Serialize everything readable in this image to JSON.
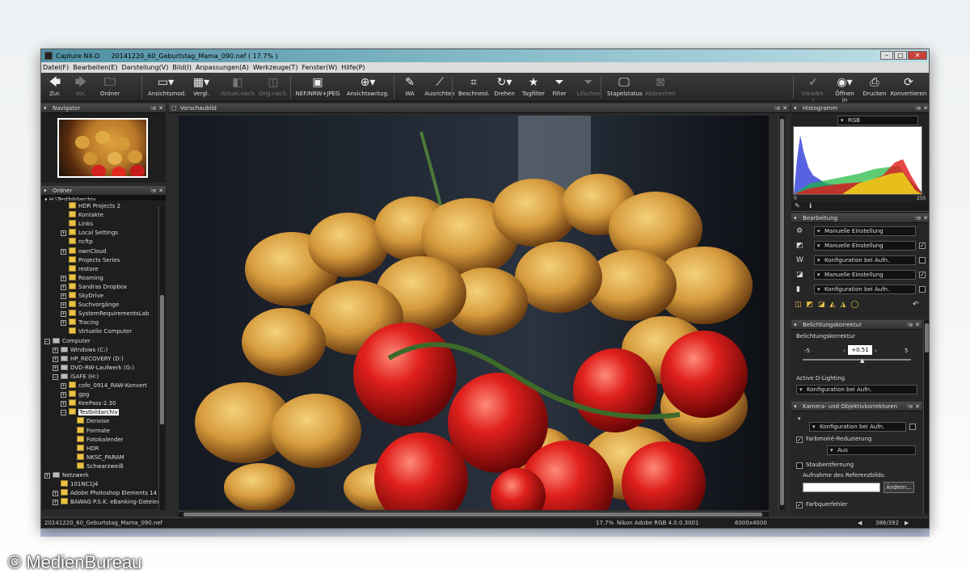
{
  "window": {
    "app_name": "Capture NX-D",
    "document_title": "20141220_60_Geburtstag_Mama_090.nef ( 17.7% )",
    "min": "–",
    "max": "□",
    "close": "✕"
  },
  "menu": [
    "Datei(F)",
    "Bearbeiten(E)",
    "Darstellung(V)",
    "Bild(I)",
    "Anpassungen(A)",
    "Werkzeuge(T)",
    "Fenster(W)",
    "Hilfe(P)"
  ],
  "toolbar": {
    "items": [
      {
        "label": "Zur.",
        "icon": "arrow-left-icon",
        "glyph": "🡄",
        "dim": false
      },
      {
        "label": "Vor.",
        "icon": "arrow-right-icon",
        "glyph": "🡆",
        "dim": true
      },
      {
        "label": "Ordner",
        "icon": "folder-icon",
        "glyph": "🗀",
        "dim": false
      },
      {
        "label": "Ansichtsmod.",
        "icon": "view-mode-icon",
        "glyph": "▭▾",
        "dim": false
      },
      {
        "label": "Vergl.",
        "icon": "compare-icon",
        "glyph": "▦▾",
        "dim": false
      },
      {
        "label": "Aktuel.nach.",
        "icon": "current-after-icon",
        "glyph": "◧",
        "dim": true
      },
      {
        "label": "Orig.nach.",
        "icon": "original-after-icon",
        "glyph": "◫",
        "dim": true
      },
      {
        "label": "NEF/NRW+JPEG",
        "icon": "nef-jpeg-icon",
        "glyph": "▣",
        "dim": false
      },
      {
        "label": "Ansichtswrkzg.",
        "icon": "view-tools-icon",
        "glyph": "⊕▾",
        "dim": false
      },
      {
        "label": "WA",
        "icon": "white-balance-icon",
        "glyph": "✎",
        "dim": false
      },
      {
        "label": "Ausrichten",
        "icon": "straighten-icon",
        "glyph": "⟋",
        "dim": false
      },
      {
        "label": "Beschneid.",
        "icon": "crop-icon",
        "glyph": "⌗",
        "dim": false
      },
      {
        "label": "Drehen",
        "icon": "rotate-icon",
        "glyph": "↻▾",
        "dim": false
      },
      {
        "label": "Tagfilter",
        "icon": "star-icon",
        "glyph": "★",
        "dim": false
      },
      {
        "label": "Filter",
        "icon": "filter-icon",
        "glyph": "⏷",
        "dim": false
      },
      {
        "label": "Löschen",
        "icon": "clear-filter-icon",
        "glyph": "⏷",
        "dim": true
      },
      {
        "label": "Stapelstatus",
        "icon": "batch-status-icon",
        "glyph": "🖵",
        "dim": false
      },
      {
        "label": "Abbrechen",
        "icon": "cancel-batch-icon",
        "glyph": "⊠",
        "dim": true
      },
      {
        "label": "ViewNX-i",
        "icon": "viewnx-icon",
        "glyph": "✔",
        "dim": true
      },
      {
        "label": "Öffnen in",
        "icon": "open-in-icon",
        "glyph": "◉▾",
        "dim": false
      },
      {
        "label": "Drucken",
        "icon": "printer-icon",
        "glyph": "⎙",
        "dim": false
      },
      {
        "label": "Konvertieren",
        "icon": "convert-icon",
        "glyph": "⟳",
        "dim": false
      }
    ]
  },
  "navigator": {
    "title": "Navigator"
  },
  "folders": {
    "title": "Ordner",
    "path": "H:\\Testbildarchiv",
    "rows": [
      {
        "label": "HDR Projects 2",
        "indent": 2,
        "type": "folder",
        "plus": false
      },
      {
        "label": "Kontakte",
        "indent": 2,
        "type": "folder",
        "plus": false
      },
      {
        "label": "Links",
        "indent": 2,
        "type": "folder",
        "plus": false
      },
      {
        "label": "Local Settings",
        "indent": 2,
        "type": "folder",
        "plus": true
      },
      {
        "label": "ncftp",
        "indent": 2,
        "type": "folder",
        "plus": false
      },
      {
        "label": "ownCloud",
        "indent": 2,
        "type": "folder",
        "plus": true
      },
      {
        "label": "Projects Series",
        "indent": 2,
        "type": "folder",
        "plus": false
      },
      {
        "label": "restore",
        "indent": 2,
        "type": "folder",
        "plus": false
      },
      {
        "label": "Roaming",
        "indent": 2,
        "type": "folder",
        "plus": true
      },
      {
        "label": "Sandras Dropbox",
        "indent": 2,
        "type": "folder",
        "plus": true
      },
      {
        "label": "SkyDrive",
        "indent": 2,
        "type": "folder",
        "plus": true
      },
      {
        "label": "Suchvorgänge",
        "indent": 2,
        "type": "folder",
        "plus": true
      },
      {
        "label": "SystemRequirementsLab",
        "indent": 2,
        "type": "folder",
        "plus": true
      },
      {
        "label": "Tracing",
        "indent": 2,
        "type": "folder",
        "plus": true
      },
      {
        "label": "Virtuelle Computer",
        "indent": 2,
        "type": "folder",
        "plus": false
      },
      {
        "label": "Computer",
        "indent": 0,
        "type": "drive",
        "plus": true
      },
      {
        "label": "Windows (C:)",
        "indent": 1,
        "type": "drive",
        "plus": true
      },
      {
        "label": "HP_RECOVERY (D:)",
        "indent": 1,
        "type": "drive",
        "plus": true
      },
      {
        "label": "DVD-RW-Laufwerk (G:)",
        "indent": 1,
        "type": "drive",
        "plus": true
      },
      {
        "label": "iSAFE (H:)",
        "indent": 1,
        "type": "drive",
        "plus": true
      },
      {
        "label": "cofo_0914_RAW-Konvert",
        "indent": 2,
        "type": "folder",
        "plus": true
      },
      {
        "label": "gpg",
        "indent": 2,
        "type": "folder",
        "plus": true
      },
      {
        "label": "KeePass-2.30",
        "indent": 2,
        "type": "folder",
        "plus": true
      },
      {
        "label": "Testbildarchiv",
        "indent": 2,
        "type": "folder",
        "plus": true,
        "selected": true
      },
      {
        "label": "Denoise",
        "indent": 3,
        "type": "folder",
        "plus": false
      },
      {
        "label": "Formate",
        "indent": 3,
        "type": "folder",
        "plus": false
      },
      {
        "label": "Fotokalender",
        "indent": 3,
        "type": "folder",
        "plus": false
      },
      {
        "label": "HDR",
        "indent": 3,
        "type": "folder",
        "plus": false
      },
      {
        "label": "NKSC_PARAM",
        "indent": 3,
        "type": "folder",
        "plus": false
      },
      {
        "label": "Schwarzweiß",
        "indent": 3,
        "type": "folder",
        "plus": false
      },
      {
        "label": "Netzwerk",
        "indent": 0,
        "type": "drive",
        "plus": true
      },
      {
        "label": "101NC1J4",
        "indent": 1,
        "type": "folder",
        "plus": false
      },
      {
        "label": "Adobe Photoshop Elements 14",
        "indent": 1,
        "type": "folder",
        "plus": true
      },
      {
        "label": "BAWAG P.S.K. eBanking-Dateien",
        "indent": 1,
        "type": "folder",
        "plus": true
      }
    ]
  },
  "preview": {
    "title": "Vorschaubild"
  },
  "status": {
    "filename": "20141220_60_Geburtstag_Mama_090.nef",
    "zoom": "17.7%",
    "profile": "Nikon Adobe RGB 4.0.0.3001",
    "dimensions": "6000x4000",
    "counter": "386/392"
  },
  "histogram": {
    "title": "Histogramm",
    "channel": "RGB",
    "min": "0",
    "max": "255"
  },
  "bearbeitung": {
    "title": "Bearbeitung",
    "rows": [
      {
        "value": "Manuelle Einstellung",
        "checked": false,
        "check_visible": false
      },
      {
        "value": "Manuelle Einstellung",
        "checked": true,
        "check_visible": true
      },
      {
        "value": "Konfiguration bei Aufn.",
        "checked": false,
        "check_visible": true
      },
      {
        "value": "Manuelle Einstellung",
        "checked": true,
        "check_visible": true
      },
      {
        "value": "Konfiguration bei Aufn.",
        "checked": false,
        "check_visible": true
      }
    ]
  },
  "belichtung": {
    "title": "Belichtungskorrektur",
    "label": "Belichtungskorrektur",
    "min": "-5",
    "max": "5",
    "value": "+0.51",
    "adl_label": "Active D-Lighting",
    "adl_value": "Konfiguration bei Aufn."
  },
  "kamera": {
    "title": "Kamera- und Objektivkorrekturen",
    "config": "Konfiguration bei Aufn.",
    "moire_label": "Farbmoiré-Reduzierung",
    "moire_value": "Aus",
    "dust_label": "Staubentfernung",
    "ref_label": "Aufnahme des Referenzbilds:",
    "change_btn": "Ändern...",
    "lateral_label": "Farbquerfehler"
  },
  "watermark": "© MedienBureau"
}
